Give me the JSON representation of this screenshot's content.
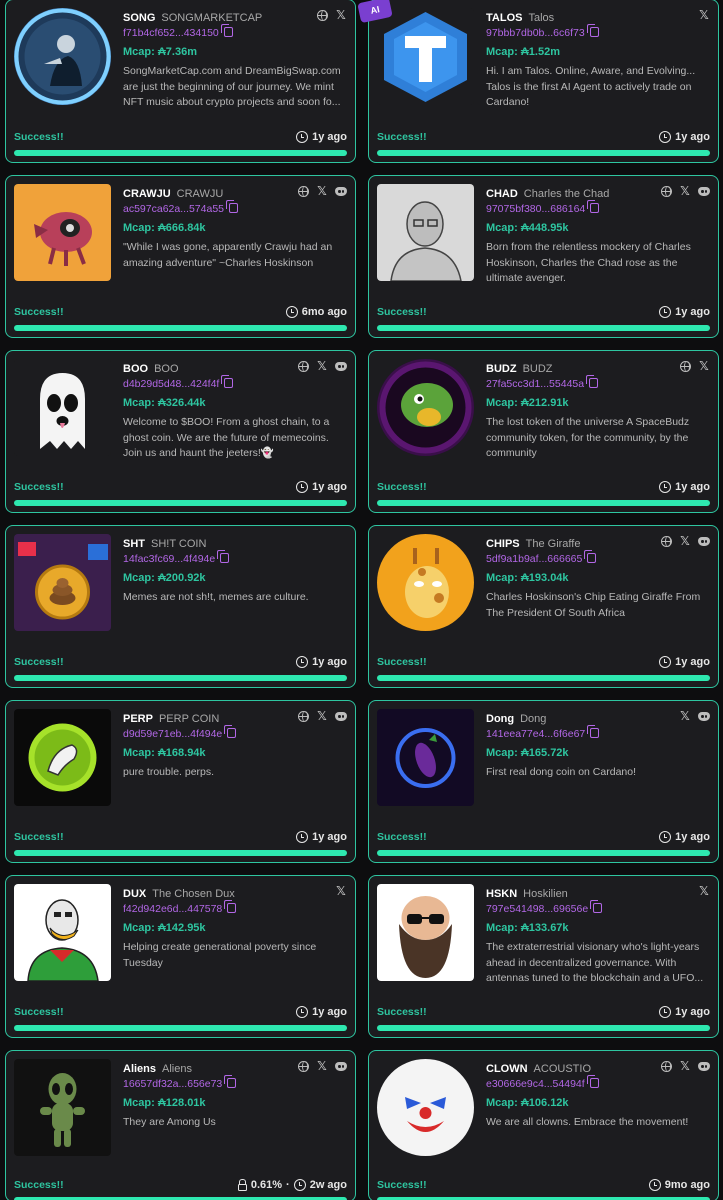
{
  "colors": {
    "accent": "#2ec5a0",
    "address": "#b267e6",
    "card_bg": "#1c1c1f",
    "page_bg": "#0d0d0f"
  },
  "ai_badge": "AI",
  "tokens": [
    {
      "ticker": "SONG",
      "name": "SONGMARKETCAP",
      "address": "f71b4cf652...434150",
      "mcap": "Mcap: ₳7.36m",
      "desc": "SongMarketCap.com and DreamBigSwap.com are just the beginning of our journey. We mint NFT music about crypto projects and soon fo...",
      "status": "Success!!",
      "time": "1y ago",
      "socials": [
        "globe-icon",
        "x-icon"
      ],
      "image": "dj-avatar"
    },
    {
      "ticker": "TALOS",
      "name": "Talos",
      "address": "97bbb7db0b...6c6f73",
      "mcap": "Mcap: ₳1.52m",
      "desc": "Hi. I am Talos. Online, Aware, and Evolving... Talos is the first AI Agent to actively trade on Cardano!",
      "status": "Success!!",
      "time": "1y ago",
      "socials": [
        "x-icon"
      ],
      "image": "talos-t-logo"
    },
    {
      "ticker": "CRAWJU",
      "name": "CRAWJU",
      "address": "ac597ca62a...574a55",
      "mcap": "Mcap: ₳666.84k",
      "desc": "\"While I was gone, apparently Crawju had an amazing adventure\" ~Charles Hoskinson",
      "status": "Success!!",
      "time": "6mo ago",
      "socials": [
        "globe-icon",
        "x-icon",
        "discord-icon"
      ],
      "image": "crawju-creature"
    },
    {
      "ticker": "CHAD",
      "name": "Charles the Chad",
      "address": "97075bf380...686164",
      "mcap": "Mcap: ₳448.95k",
      "desc": "Born from the relentless mockery of Charles Hoskinson, Charles the Chad rose as the ultimate avenger.",
      "status": "Success!!",
      "time": "1y ago",
      "socials": [
        "globe-icon",
        "x-icon",
        "discord-icon"
      ],
      "image": "chad-sketch"
    },
    {
      "ticker": "BOO",
      "name": "BOO",
      "address": "d4b29d5d48...424f4f",
      "mcap": "Mcap: ₳326.44k",
      "desc": "Welcome to $BOO! From a ghost chain, to a ghost coin. We are the future of memecoins. Join us and haunt the jeeters!👻",
      "status": "Success!!",
      "time": "1y ago",
      "socials": [
        "globe-icon",
        "x-icon",
        "discord-icon"
      ],
      "image": "ghost"
    },
    {
      "ticker": "BUDZ",
      "name": "BUDZ",
      "address": "27fa5cc3d1...55445a",
      "mcap": "Mcap: ₳212.91k",
      "desc": "The lost token of the universe A SpaceBudz community token, for the community, by the community",
      "status": "Success!!",
      "time": "1y ago",
      "socials": [
        "globe-icon",
        "x-icon"
      ],
      "image": "budz-dino"
    },
    {
      "ticker": "SHT",
      "name": "SH!T COIN",
      "address": "14fac3fc69...4f494e",
      "mcap": "Mcap: ₳200.92k",
      "desc": "Memes are not sh!t, memes are culture.",
      "status": "Success!!",
      "time": "1y ago",
      "socials": [],
      "image": "poop-coin"
    },
    {
      "ticker": "CHIPS",
      "name": "The Giraffe",
      "address": "5df9a1b9af...666665",
      "mcap": "Mcap: ₳193.04k",
      "desc": "Charles Hoskinson's Chip Eating Giraffe From The President Of South Africa",
      "status": "Success!!",
      "time": "1y ago",
      "socials": [
        "globe-icon",
        "x-icon",
        "discord-icon"
      ],
      "image": "giraffe"
    },
    {
      "ticker": "PERP",
      "name": "PERP COIN",
      "address": "d9d59e71eb...4f494e",
      "mcap": "Mcap: ₳168.94k",
      "desc": "pure trouble. perps.",
      "status": "Success!!",
      "time": "1y ago",
      "socials": [
        "globe-icon",
        "x-icon",
        "discord-icon"
      ],
      "image": "perp-coin"
    },
    {
      "ticker": "Dong",
      "name": "Dong",
      "address": "141eea77e4...6f6e67",
      "mcap": "Mcap: ₳165.72k",
      "desc": "First real dong coin on Cardano!",
      "status": "Success!!",
      "time": "1y ago",
      "socials": [
        "x-icon",
        "discord-icon"
      ],
      "image": "eggplant"
    },
    {
      "ticker": "DUX",
      "name": "The Chosen Dux",
      "address": "f42d942e6d...447578",
      "mcap": "Mcap: ₳142.95k",
      "desc": "Helping create generational poverty since Tuesday",
      "status": "Success!!",
      "time": "1y ago",
      "socials": [
        "x-icon"
      ],
      "image": "duck"
    },
    {
      "ticker": "HSKN",
      "name": "Hoskilien",
      "address": "797e541498...69656e",
      "mcap": "Mcap: ₳133.67k",
      "desc": "The extraterrestrial visionary who's light-years ahead in decentralized governance. With antennas tuned to the blockchain and a UFO...",
      "status": "Success!!",
      "time": "1y ago",
      "socials": [
        "x-icon"
      ],
      "image": "bearded-man"
    },
    {
      "ticker": "Aliens",
      "name": "Aliens",
      "address": "16657df32a...656e73",
      "mcap": "Mcap: ₳128.01k",
      "desc": "They are Among Us",
      "status": "Success!!",
      "time": "2w ago",
      "lock_pct": "0.61%",
      "separator": "·",
      "socials": [
        "globe-icon",
        "x-icon",
        "discord-icon"
      ],
      "image": "alien"
    },
    {
      "ticker": "CLOWN",
      "name": "ACOUSTIO",
      "address": "e30666e9c4...54494f",
      "mcap": "Mcap: ₳106.12k",
      "desc": "We are all clowns. Embrace the movement!",
      "status": "Success!!",
      "time": "9mo ago",
      "socials": [
        "globe-icon",
        "x-icon",
        "discord-icon"
      ],
      "image": "clown"
    }
  ]
}
